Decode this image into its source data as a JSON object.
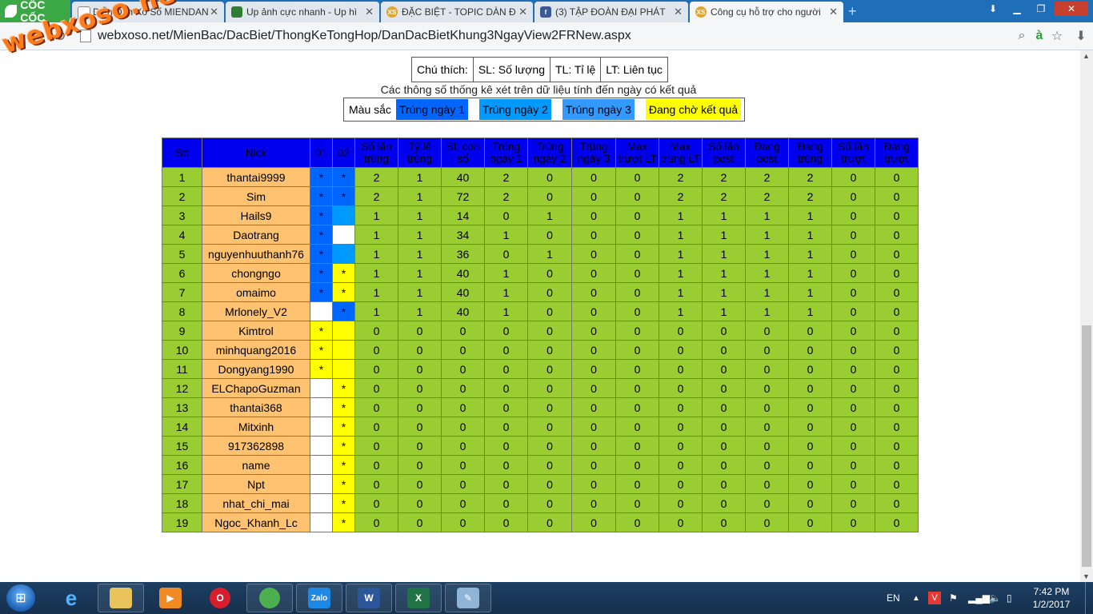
{
  "browser": {
    "brand": "CỐC CỐC",
    "tabs": [
      {
        "title": "Diễn Đàn Xổ Số MIENDAN",
        "icon": "page-icon",
        "active": false
      },
      {
        "title": "Up ảnh cực nhanh - Up hì",
        "icon": "image-icon",
        "active": false
      },
      {
        "title": "ĐẶC BIỆT - TOPIC DÀN Đ",
        "icon": "xs-icon",
        "active": false
      },
      {
        "title": "(3) TẬP ĐOÀN ĐẠI PHÁT",
        "icon": "facebook-icon",
        "active": false
      },
      {
        "title": "Công cụ hỗ trợ cho người",
        "icon": "xs-icon",
        "active": true
      }
    ],
    "address": "webxoso.net/MienBac/DacBiet/ThongKeTongHop/DanDacBietKhung3NgayView2FRNew.aspx",
    "watermark": "webxoso.net"
  },
  "legend": {
    "items": [
      "Chú thích:",
      "SL: Số lượng",
      "TL: Tỉ lệ",
      "LT: Liên tục"
    ],
    "note": "Các thông số thống kê xét trên dữ liệu tính đến ngày có kết quả",
    "color_label": "Màu sắc",
    "colors": [
      {
        "label": "Trúng ngày 1",
        "color": "#0066ff"
      },
      {
        "label": "Trúng ngày 2",
        "color": "#0099ff"
      },
      {
        "label": "Trúng ngày 3",
        "color": "#3399ff"
      },
      {
        "label": "Đang chờ kết quả",
        "color": "#ffff00"
      }
    ]
  },
  "table": {
    "headers": [
      "Stt",
      "Nick",
      "01",
      "02",
      "Số lần trúng",
      "Tỷ lệ trúng",
      "SL con số",
      "Trúng ngày 1",
      "Trúng ngày 2",
      "Trúng ngày 3",
      "Max trượt LT",
      "Max trúng LT",
      "Số lần post",
      "Đang post",
      "Đang trúng",
      "Số lần trượt",
      "Đang trượt"
    ],
    "rows": [
      {
        "stt": "1",
        "nick": "thantai9999",
        "d1": "*",
        "c1": "b1",
        "d2": "*",
        "c2": "b1",
        "v": [
          "2",
          "1",
          "40",
          "2",
          "0",
          "0",
          "0",
          "2",
          "2",
          "2",
          "2",
          "0",
          "0"
        ]
      },
      {
        "stt": "2",
        "nick": "Sim",
        "d1": "*",
        "c1": "b1",
        "d2": "*",
        "c2": "b1",
        "v": [
          "2",
          "1",
          "72",
          "2",
          "0",
          "0",
          "0",
          "2",
          "2",
          "2",
          "2",
          "0",
          "0"
        ]
      },
      {
        "stt": "3",
        "nick": "Hails9",
        "d1": "*",
        "c1": "b1",
        "d2": "",
        "c2": "b2",
        "v": [
          "1",
          "1",
          "14",
          "0",
          "1",
          "0",
          "0",
          "1",
          "1",
          "1",
          "1",
          "0",
          "0"
        ]
      },
      {
        "stt": "4",
        "nick": "Daotrang",
        "d1": "*",
        "c1": "b1",
        "d2": "",
        "c2": "w",
        "v": [
          "1",
          "1",
          "34",
          "1",
          "0",
          "0",
          "0",
          "1",
          "1",
          "1",
          "1",
          "0",
          "0"
        ]
      },
      {
        "stt": "5",
        "nick": "nguyenhuuthanh76",
        "d1": "*",
        "c1": "b1",
        "d2": "",
        "c2": "b2",
        "v": [
          "1",
          "1",
          "36",
          "0",
          "1",
          "0",
          "0",
          "1",
          "1",
          "1",
          "1",
          "0",
          "0"
        ]
      },
      {
        "stt": "6",
        "nick": "chongngo",
        "d1": "*",
        "c1": "b1",
        "d2": "*",
        "c2": "y",
        "v": [
          "1",
          "1",
          "40",
          "1",
          "0",
          "0",
          "0",
          "1",
          "1",
          "1",
          "1",
          "0",
          "0"
        ]
      },
      {
        "stt": "7",
        "nick": "omaimo",
        "d1": "*",
        "c1": "b1",
        "d2": "*",
        "c2": "y",
        "v": [
          "1",
          "1",
          "40",
          "1",
          "0",
          "0",
          "0",
          "1",
          "1",
          "1",
          "1",
          "0",
          "0"
        ]
      },
      {
        "stt": "8",
        "nick": "Mrlonely_V2",
        "d1": "",
        "c1": "w",
        "d2": "*",
        "c2": "b1",
        "v": [
          "1",
          "1",
          "40",
          "1",
          "0",
          "0",
          "0",
          "1",
          "1",
          "1",
          "1",
          "0",
          "0"
        ]
      },
      {
        "stt": "9",
        "nick": "Kimtrol",
        "d1": "*",
        "c1": "y",
        "d2": "",
        "c2": "y",
        "v": [
          "0",
          "0",
          "0",
          "0",
          "0",
          "0",
          "0",
          "0",
          "0",
          "0",
          "0",
          "0",
          "0"
        ]
      },
      {
        "stt": "10",
        "nick": "minhquang2016",
        "d1": "*",
        "c1": "y",
        "d2": "",
        "c2": "y",
        "v": [
          "0",
          "0",
          "0",
          "0",
          "0",
          "0",
          "0",
          "0",
          "0",
          "0",
          "0",
          "0",
          "0"
        ]
      },
      {
        "stt": "11",
        "nick": "Dongyang1990",
        "d1": "*",
        "c1": "y",
        "d2": "",
        "c2": "y",
        "v": [
          "0",
          "0",
          "0",
          "0",
          "0",
          "0",
          "0",
          "0",
          "0",
          "0",
          "0",
          "0",
          "0"
        ]
      },
      {
        "stt": "12",
        "nick": "ELChapoGuzman",
        "d1": "",
        "c1": "w",
        "d2": "*",
        "c2": "y",
        "v": [
          "0",
          "0",
          "0",
          "0",
          "0",
          "0",
          "0",
          "0",
          "0",
          "0",
          "0",
          "0",
          "0"
        ]
      },
      {
        "stt": "13",
        "nick": "thantai368",
        "d1": "",
        "c1": "w",
        "d2": "*",
        "c2": "y",
        "v": [
          "0",
          "0",
          "0",
          "0",
          "0",
          "0",
          "0",
          "0",
          "0",
          "0",
          "0",
          "0",
          "0"
        ]
      },
      {
        "stt": "14",
        "nick": "Mitxinh",
        "d1": "",
        "c1": "w",
        "d2": "*",
        "c2": "y",
        "v": [
          "0",
          "0",
          "0",
          "0",
          "0",
          "0",
          "0",
          "0",
          "0",
          "0",
          "0",
          "0",
          "0"
        ]
      },
      {
        "stt": "15",
        "nick": "917362898",
        "d1": "",
        "c1": "w",
        "d2": "*",
        "c2": "y",
        "v": [
          "0",
          "0",
          "0",
          "0",
          "0",
          "0",
          "0",
          "0",
          "0",
          "0",
          "0",
          "0",
          "0"
        ]
      },
      {
        "stt": "16",
        "nick": "name",
        "d1": "",
        "c1": "w",
        "d2": "*",
        "c2": "y",
        "v": [
          "0",
          "0",
          "0",
          "0",
          "0",
          "0",
          "0",
          "0",
          "0",
          "0",
          "0",
          "0",
          "0"
        ]
      },
      {
        "stt": "17",
        "nick": "Npt",
        "d1": "",
        "c1": "w",
        "d2": "*",
        "c2": "y",
        "v": [
          "0",
          "0",
          "0",
          "0",
          "0",
          "0",
          "0",
          "0",
          "0",
          "0",
          "0",
          "0",
          "0"
        ]
      },
      {
        "stt": "18",
        "nick": "nhat_chi_mai",
        "d1": "",
        "c1": "w",
        "d2": "*",
        "c2": "y",
        "v": [
          "0",
          "0",
          "0",
          "0",
          "0",
          "0",
          "0",
          "0",
          "0",
          "0",
          "0",
          "0",
          "0"
        ]
      },
      {
        "stt": "19",
        "nick": "Ngoc_Khanh_Lc",
        "d1": "",
        "c1": "w",
        "d2": "*",
        "c2": "y",
        "v": [
          "0",
          "0",
          "0",
          "0",
          "0",
          "0",
          "0",
          "0",
          "0",
          "0",
          "0",
          "0",
          "0"
        ]
      }
    ]
  },
  "taskbar": {
    "apps": [
      "explorer",
      "internet-explorer",
      "file-manager",
      "media-player",
      "opera",
      "coccoc",
      "zalo",
      "word",
      "excel",
      "paint"
    ],
    "zalo_label": "Zalo",
    "lang": "EN",
    "time": "7:42 PM",
    "date": "1/2/2017"
  }
}
